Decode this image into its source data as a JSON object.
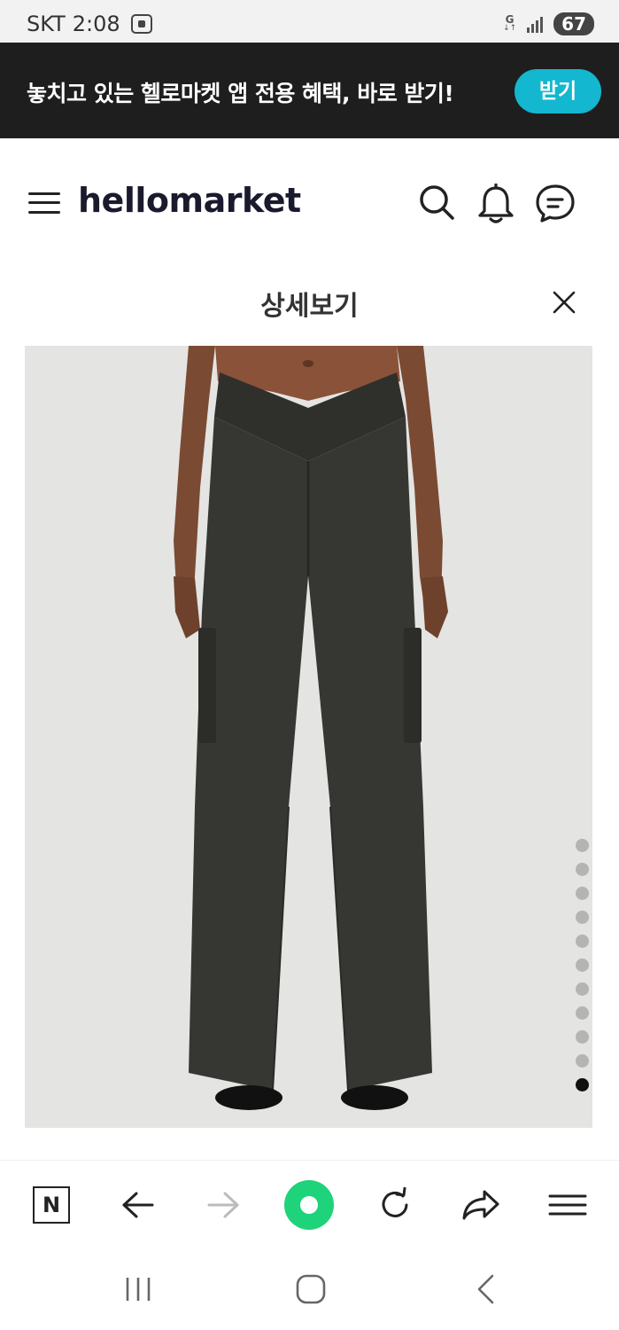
{
  "status_bar": {
    "carrier": "SKT",
    "time": "2:08",
    "network": "G",
    "battery": "67"
  },
  "promo": {
    "text": "놓치고 있는 헬로마켓 앱 전용 혜택, 바로 받기!",
    "button_label": "받기",
    "accent_color": "#13b7cf"
  },
  "header": {
    "logo": "hellomarket",
    "icons": [
      "menu-icon",
      "search-icon",
      "bell-icon",
      "chat-icon"
    ]
  },
  "detail": {
    "title": "상세보기",
    "close_icon": "close-icon"
  },
  "gallery": {
    "image_alt": "black cargo wide pants product photo",
    "total_images": 11,
    "active_index": 11
  },
  "browser_toolbar": {
    "icons": [
      "naver-n-icon",
      "back-arrow-icon",
      "forward-arrow-icon",
      "green-dot-home-icon",
      "refresh-icon",
      "share-icon",
      "hamburger-menu-icon"
    ],
    "naver_label": "N"
  },
  "nav_bar": {
    "icons": [
      "recent-apps-icon",
      "home-icon",
      "back-icon"
    ]
  }
}
